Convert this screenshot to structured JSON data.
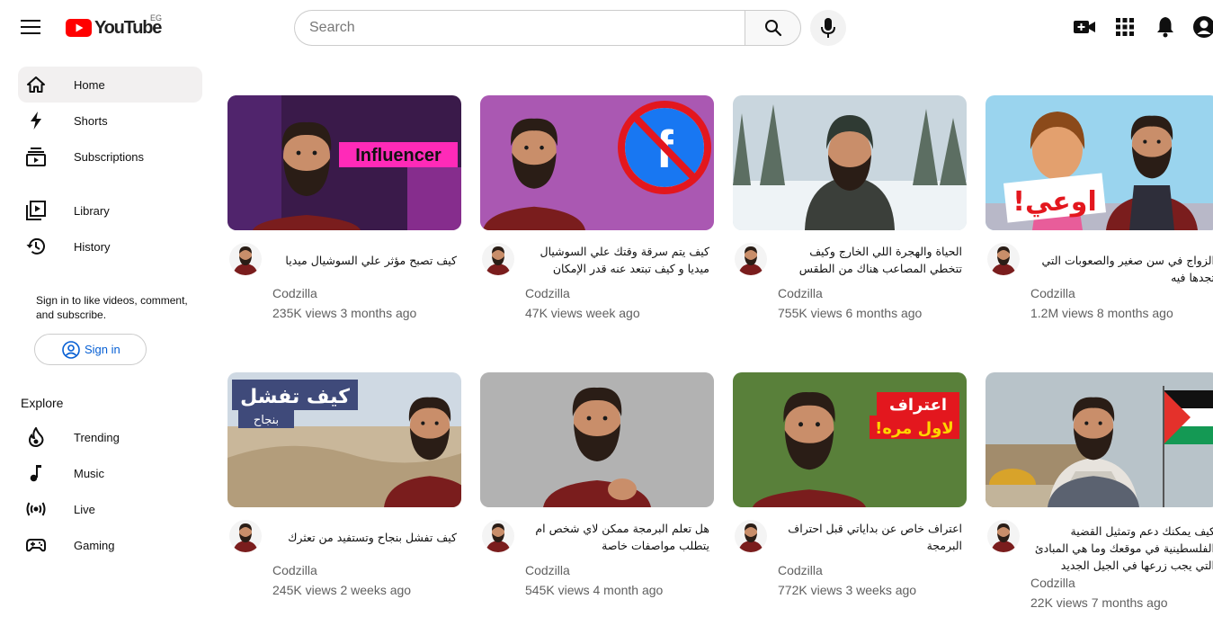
{
  "header": {
    "logo_text": "YouTube",
    "country_code": "EG",
    "search_placeholder": "Search"
  },
  "sidebar": {
    "items": [
      {
        "label": "Home",
        "icon": "home-icon",
        "active": true
      },
      {
        "label": "Shorts",
        "icon": "shorts-icon"
      },
      {
        "label": "Subscriptions",
        "icon": "subscriptions-icon"
      },
      {
        "label": "Library",
        "icon": "library-icon"
      },
      {
        "label": "History",
        "icon": "history-icon"
      }
    ],
    "signin_prompt": "Sign in to like videos, comment, and subscribe.",
    "signin_label": "Sign in",
    "explore_title": "Explore",
    "explore_items": [
      {
        "label": "Trending",
        "icon": "trending-icon"
      },
      {
        "label": "Music",
        "icon": "music-icon"
      },
      {
        "label": "Live",
        "icon": "live-icon"
      },
      {
        "label": "Gaming",
        "icon": "gaming-icon"
      }
    ]
  },
  "videos": [
    {
      "title": "كيف تصبح مؤثر علي السوشيال ميديا",
      "channel": "Codzilla",
      "meta": "235K views 3 months ago",
      "thumb_text": "Influencer",
      "thumb_bg": "#3a1a4a"
    },
    {
      "title": "كيف يتم سرقة وقتك علي السوشيال ميديا و كيف تبتعد عنه قدر الإمكان",
      "channel": "Codzilla",
      "meta": "47K views week ago",
      "thumb_text": "f",
      "thumb_bg": "#8a4fb8"
    },
    {
      "title": "الحياة والهجرة اللي الخارج وكيف تتخطي المصاعب هناك من الطقس",
      "channel": "Codzilla",
      "meta": "755K views 6 months ago",
      "thumb_text": "",
      "thumb_bg": "#c9d6de"
    },
    {
      "title": "الزواج في سن صغير والصعوبات التي تجدها فيه",
      "channel": "Codzilla",
      "meta": "1.2M views 8 months ago",
      "thumb_text": "اوعي!",
      "thumb_bg": "#9ad4ee"
    },
    {
      "title": "كيف تفشل بنجاح وتستفيد من تعثرك",
      "channel": "Codzilla",
      "meta": "245K views 2 weeks ago",
      "thumb_text": "كيف تفشل",
      "thumb_sub": "بنجاح",
      "thumb_bg": "#c9b79a"
    },
    {
      "title": "هل تعلم البرمجة ممكن لاي شخص ام يتطلب مواصفات خاصة",
      "channel": "Codzilla",
      "meta": "545K views 4 month ago",
      "thumb_text": "",
      "thumb_bg": "#a7a7a7"
    },
    {
      "title": "اعتراف خاص عن بداياتي قبل احتراف البرمجة",
      "channel": "Codzilla",
      "meta": "772K views 3 weeks ago",
      "thumb_text": "اعتراف",
      "thumb_sub": "لاول مره!",
      "thumb_bg": "#3f6a2a"
    },
    {
      "title": "كيف يمكنك دعم وتمثيل القضية الفلسطينية في موقعك وما هي المبادئ التي يجب زرعها في الجيل الجديد",
      "channel": "Codzilla",
      "meta": "22K views 7 months ago",
      "thumb_text": "",
      "thumb_bg": "#b8c3c9"
    }
  ],
  "colors": {
    "brand_red": "#ff0000",
    "link_blue": "#065fd4",
    "meta_gray": "#606060",
    "active_bg": "#f2f0f0"
  }
}
